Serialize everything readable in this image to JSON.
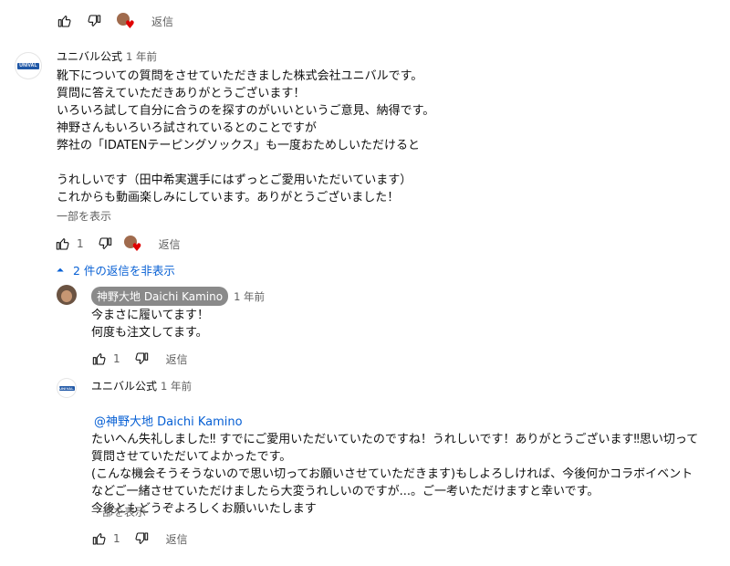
{
  "top_actions": {
    "reply_label": "返信"
  },
  "main_comment": {
    "avatar_logo_text": "UNIVAL",
    "author": "ユニバル公式",
    "time": "1 年前",
    "body": "靴下についての質問をさせていただきました株式会社ユニバルです。\n質問に答えていただきありがとうございます！\nいろいろ試して自分に合うのを探すのがいいというご意見、納得です。\n神野さんもいろいろ試されているとのことですが\n弊社の「IDATENテーピングソックス」も一度おためしいただけると\n\nうれしいです（田中希実選手にはずっとご愛用いただいています）\nこれからも動画楽しみにしています。ありがとうございました！",
    "more_label": "一部を表示",
    "like_count": "1",
    "reply_label": "返信"
  },
  "replies_toggle": {
    "label": "2 件の返信を非表示"
  },
  "reply1": {
    "author": "神野大地 Daichi Kamino",
    "time": "1 年前",
    "body": "今まさに履いてます！\n何度も注文してます。",
    "like_count": "1",
    "reply_label": "返信"
  },
  "reply2": {
    "avatar_logo_text": "UNIVAL",
    "author": "ユニバル公式",
    "time": "1 年前",
    "mention": "@神野大地 Daichi Kamino",
    "body": "たいへん失礼しました‼ すでにご愛用いただいていたのですね！うれしいです！ありがとうございます‼思い切って\n質問させていただいてよかったです。\n(こんな機会そうそうないので思い切ってお願いさせていただきます)もしよろしければ、今後何かコラボイベント\nなどご一緒させていただけましたら大変うれしいのですが...。ご一考いただけますと幸いです。\n今後ともどうぞよろしくお願いいたします",
    "more_label": "一部を表示",
    "like_count": "1",
    "reply_label": "返信"
  },
  "colors": {
    "link": "#065fd4",
    "heart": "#e00000",
    "logo": "#1f57a6"
  },
  "icons": [
    "thumb-up-icon",
    "thumb-down-icon",
    "heart-icon",
    "chevron-up-icon"
  ]
}
